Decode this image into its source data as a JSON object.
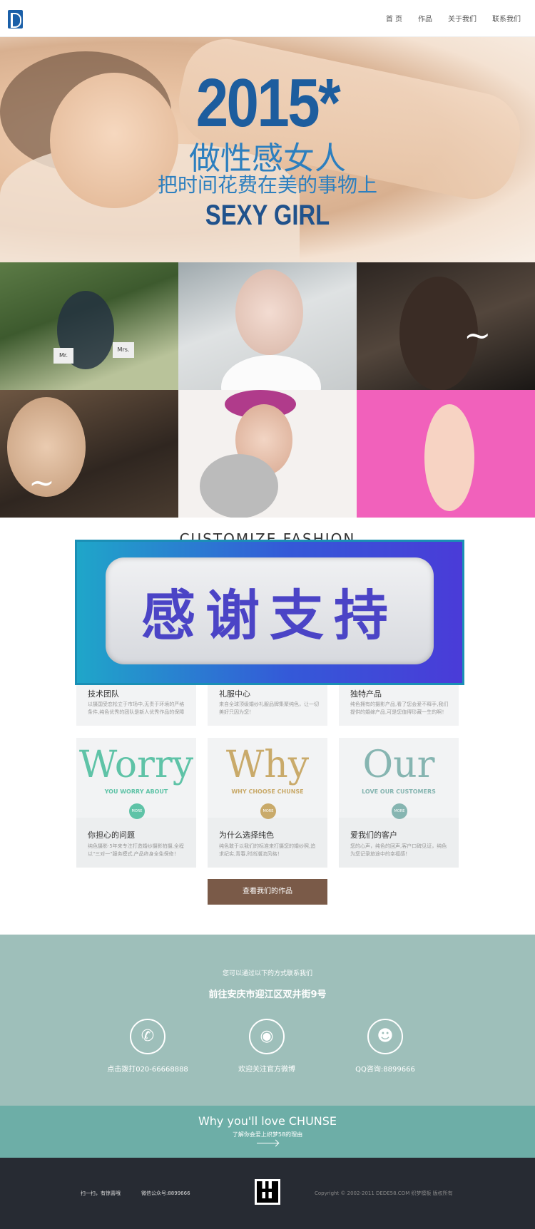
{
  "nav": {
    "items": [
      "首 页",
      "作品",
      "关于我们",
      "联系我们"
    ]
  },
  "hero": {
    "year": "2015*",
    "line1": "做性感女人",
    "line2": "把时间花费在美的事物上",
    "line3": "SEXY GIRL"
  },
  "gallery": {
    "t1_text_a": "Mr.",
    "t1_text_b": "Mrs."
  },
  "section": {
    "title": "CUSTOMIZE FASHION",
    "overlay_text": "感谢支持"
  },
  "cards_top": [
    {
      "title": "技术团队",
      "desc": "以摄国受恋松立于市场中,无责于环境的严格条件,纯色优秀的团队是新人优秀作品的保障"
    },
    {
      "title": "礼服中心",
      "desc": "来自全球顶级婚纱礼服品牌集聚纯色，让一切美好只因为您！"
    },
    {
      "title": "独特产品",
      "desc": "纯色拥有的摄影产品,看了您会爱不释手,我们提供的婚嫁产品,可是您值得珍藏一生的啊！"
    }
  ],
  "cards_bottom": [
    {
      "big": "Worry",
      "sub": "YOU WORRY ABOUT",
      "more": "MORE",
      "title": "你担心的问题",
      "desc": "纯色摄影·5年来专注打造婚纱摄影拍摄,全程以\"三对一\"服务模式,产品终身全免保修！",
      "color": "#5fc3a7"
    },
    {
      "big": "Why",
      "sub": "WHY CHOOSE CHUNSE",
      "more": "MORE",
      "title": "为什么选择纯色",
      "desc": "纯色敢于以我们的标准来打摄您的婚纱照,追求纪实,青春,时尚潮流风格！",
      "color": "#c9aa6a"
    },
    {
      "big": "Our",
      "sub": "LOVE OUR CUSTOMERS",
      "more": "MORE",
      "title": "爱我们的客户",
      "desc": "您的心声，纯色的回声,客户口碑见证，纯色为您记录旅途中的幸福感！",
      "color": "#86b5b1"
    }
  ],
  "works_button": "查看我们的作品",
  "contact": {
    "lead": "您可以通过以下的方式联系我们",
    "address": "前往安庆市迎江区双井街9号",
    "items": [
      {
        "icon": "phone-icon",
        "label": "点击拨打020-66668888"
      },
      {
        "icon": "weibo-icon",
        "label": "欢迎关注官方微博"
      },
      {
        "icon": "qq-icon",
        "label": "QQ咨询:8899666"
      }
    ]
  },
  "love": {
    "title": "Why you'll love CHUNSE",
    "subtitle": "了解你会爱上织梦58的理由"
  },
  "footer": {
    "scan": "扫一扫，有惊喜哦",
    "wechat": "微信公众号:8899666",
    "copyright": "Copyright © 2002-2011 DEDE58.COM 织梦模板 版权所有"
  },
  "colors": {
    "accent_green": "#5fc3a7",
    "accent_gold": "#c9aa6a",
    "accent_teal": "#86b5b1",
    "button_brown": "#7a5a48",
    "contact_bg": "#9ebfba",
    "love_bg": "#6daea7",
    "footer_bg": "#272b33"
  }
}
